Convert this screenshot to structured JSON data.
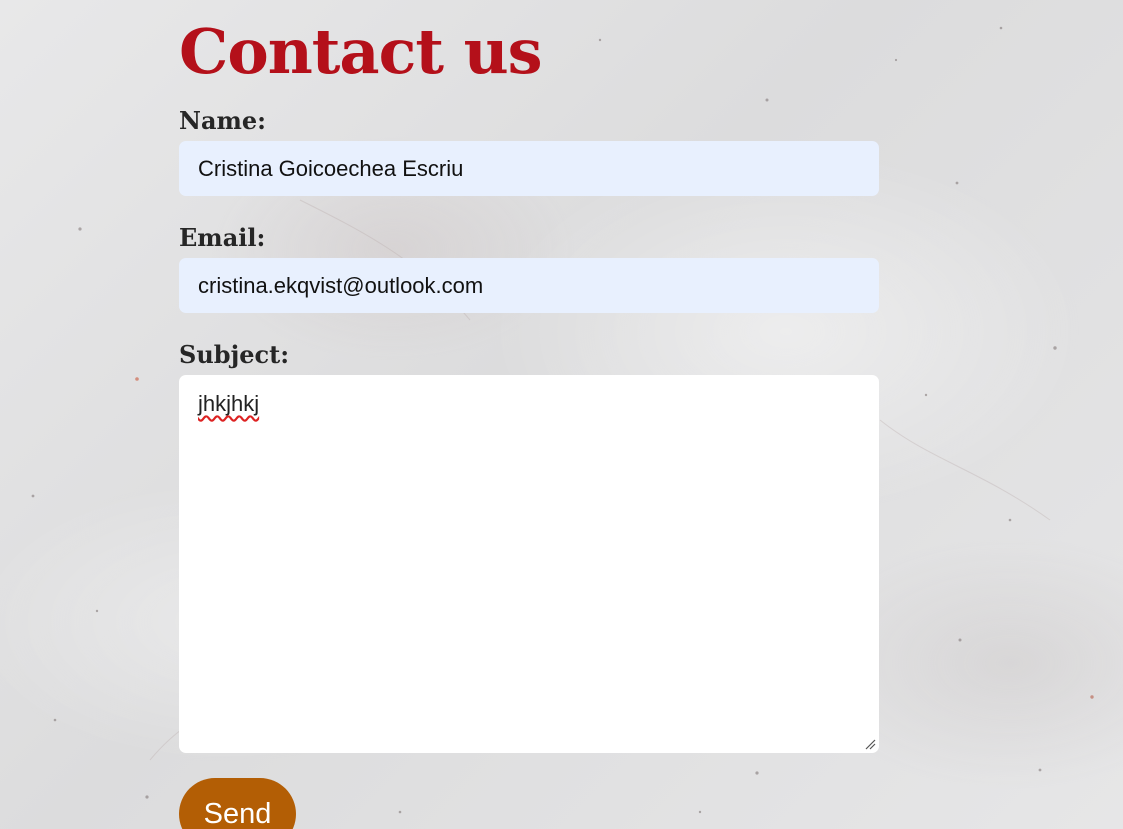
{
  "page": {
    "title": "Contact us",
    "title_color": "#b4101a",
    "background_color": "#e3e3e4"
  },
  "form": {
    "name": {
      "label": "Name:",
      "value": "Cristina Goicoechea Escriu",
      "background": "#e8f0fe"
    },
    "email": {
      "label": "Email:",
      "value": "cristina.ekqvist@outlook.com",
      "background": "#e8f0fe"
    },
    "subject": {
      "label": "Subject:",
      "value": "jhkjhkj",
      "spellcheck_flagged": true
    },
    "send": {
      "label": "Send",
      "color": "#b35e05"
    }
  },
  "icons": {
    "resize": "resize-grip-icon"
  }
}
